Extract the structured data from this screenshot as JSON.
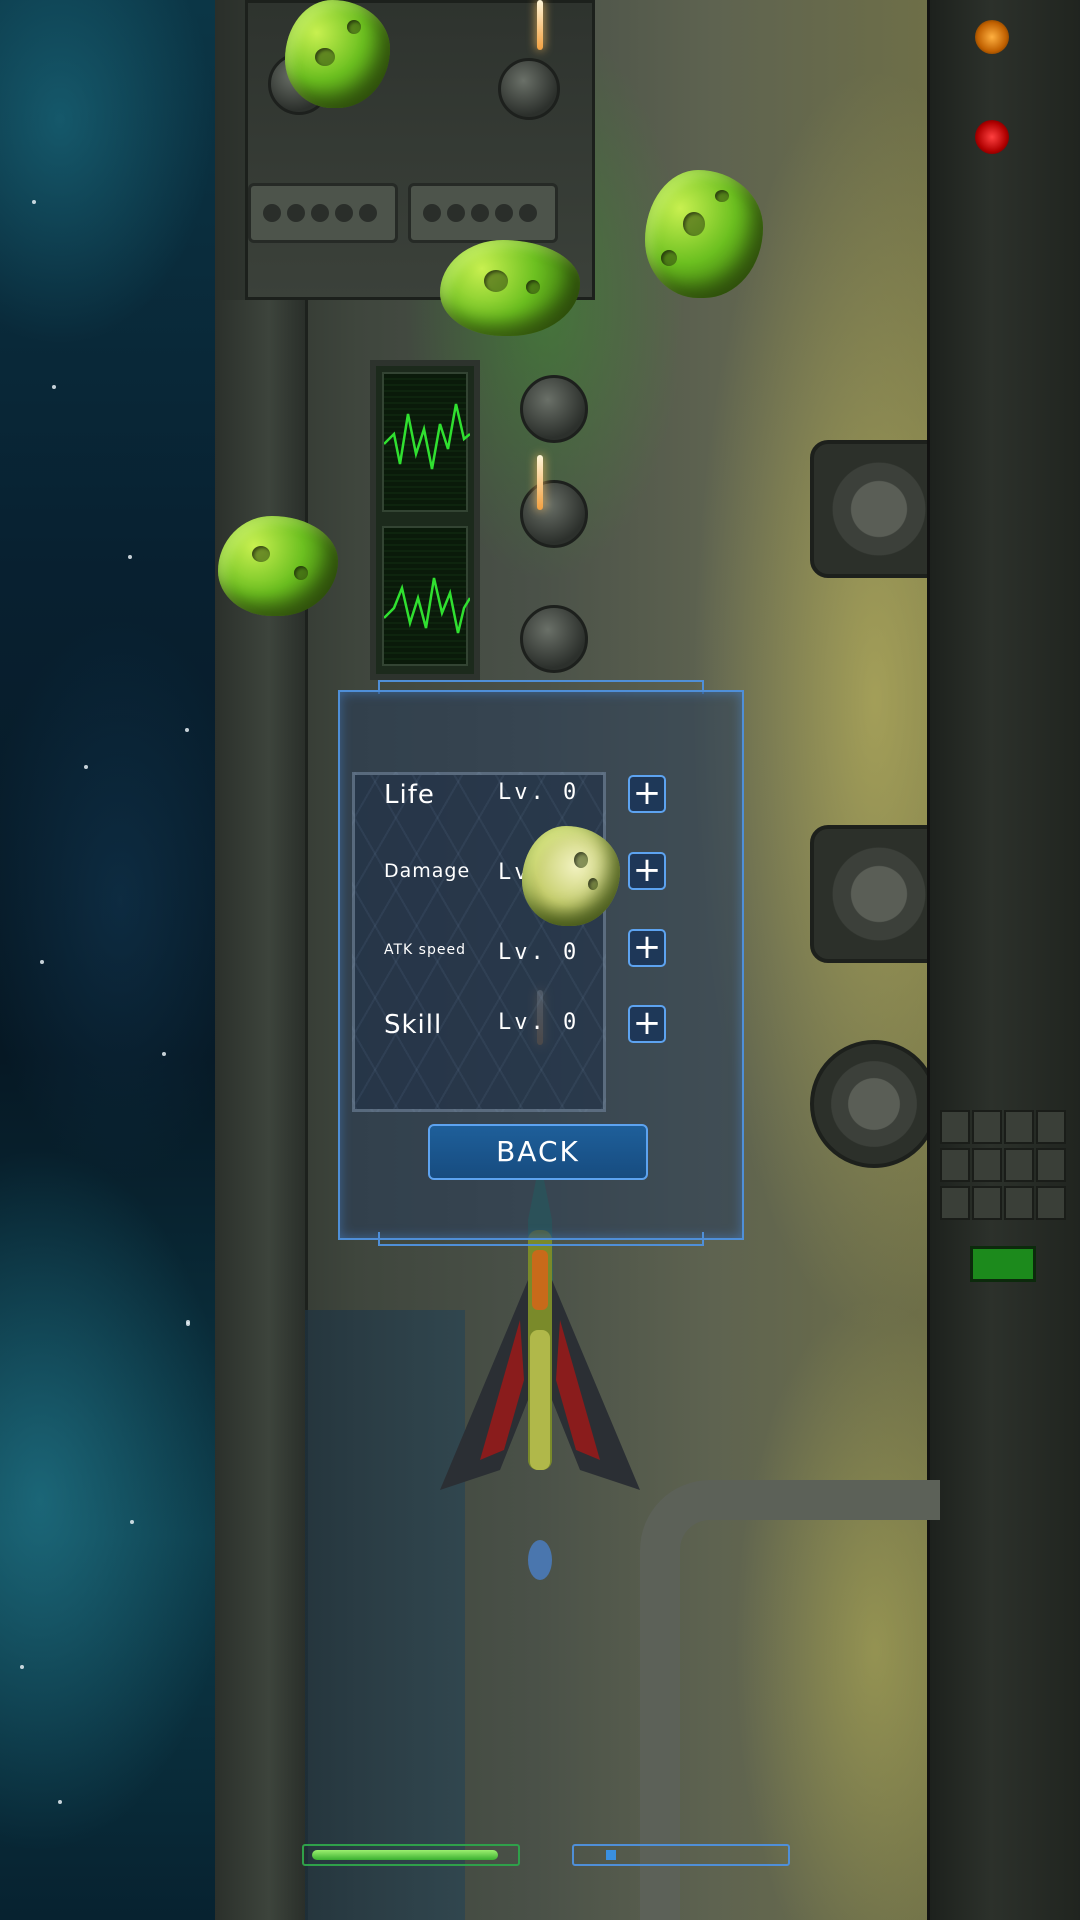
{
  "upgrade_menu": {
    "stats": [
      {
        "name": "Life",
        "level": "Lv. 0",
        "add_label": "+"
      },
      {
        "name": "Damage",
        "level": "Lv. 0",
        "add_label": "+"
      },
      {
        "name": "ATK speed",
        "level": "Lv. 0",
        "add_label": "+"
      },
      {
        "name": "Skill",
        "level": "Lv. 0",
        "add_label": "+"
      }
    ],
    "back_label": "BACK"
  },
  "hud": {
    "life_bar_fill": 0.92,
    "skill_bar_fill": 0.05
  },
  "colors": {
    "ui_accent": "#5da3f0",
    "life_bar": "#3ab030",
    "skill_bar": "#3a90e0",
    "asteroid_green": "#7ccc28"
  }
}
